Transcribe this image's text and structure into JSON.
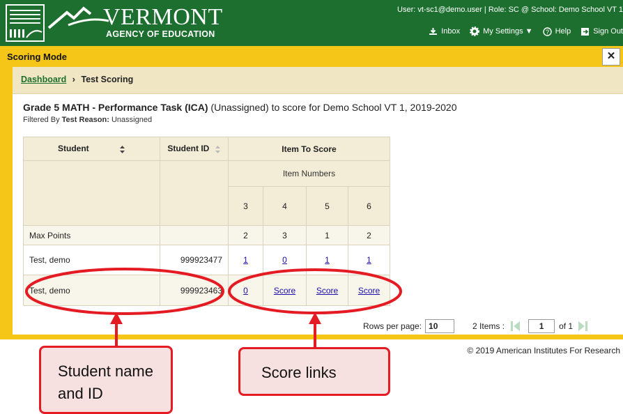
{
  "header": {
    "logo_word": "VERMONT",
    "logo_sub": "AGENCY OF EDUCATION",
    "user_line": "User: vt-sc1@demo.user  |  Role: SC @ School: Demo School VT 1",
    "nav": {
      "inbox": "Inbox",
      "settings": "My Settings ▼",
      "help": "Help",
      "signout": "Sign Out"
    }
  },
  "mode_bar": {
    "title": "Scoring Mode",
    "close": "✕"
  },
  "breadcrumb": {
    "link": "Dashboard",
    "separator": "›",
    "current": "Test Scoring"
  },
  "heading": {
    "bold": "Grade 5 MATH - Performance Task (ICA)",
    "rest": " (Unassigned) to score for Demo School VT 1, 2019-2020"
  },
  "filter": {
    "prefix": "Filtered By ",
    "label": "Test Reason:",
    "value": " Unassigned"
  },
  "table": {
    "col_student": "Student",
    "col_id": "Student ID",
    "col_item": "Item To Score",
    "sub_header": "Item Numbers",
    "items": [
      "3",
      "4",
      "5",
      "6"
    ],
    "max_label": "Max Points",
    "max_values": [
      "2",
      "3",
      "1",
      "2"
    ],
    "rows": [
      {
        "name": "Test, demo",
        "id": "999923477",
        "scores": [
          "1",
          "0",
          "1",
          "1"
        ]
      },
      {
        "name": "Test, demo",
        "id": "999923463",
        "scores": [
          "0",
          "Score",
          "Score",
          "Score"
        ]
      }
    ]
  },
  "pager": {
    "rows_label": "Rows per page:",
    "rows_value": "10",
    "items": "2 Items :",
    "page": "1",
    "of": "of 1"
  },
  "footer": "© 2019 American Institutes For Research",
  "callouts": {
    "student": "Student name and ID",
    "scores": "Score links"
  },
  "colors": {
    "header_green": "#1d6f2f",
    "yellow": "#f5c518",
    "annotation_red": "#e41b23"
  }
}
